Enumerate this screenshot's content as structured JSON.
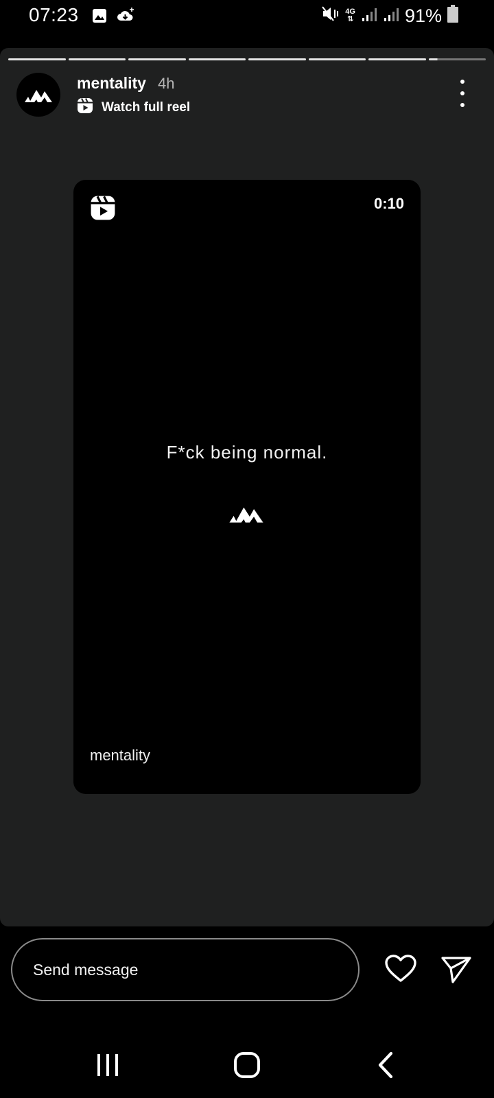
{
  "status_bar": {
    "time": "07:23",
    "network": "4G",
    "battery": "91%",
    "icons": [
      "gallery-icon",
      "cloud-download-icon",
      "mute-vibrate-icon",
      "signal-icon",
      "signal-icon",
      "battery-icon"
    ]
  },
  "story": {
    "progress_segments": 8,
    "active_segment_progress": 0.15,
    "username": "mentality",
    "time_ago": "4h",
    "reel_link_label": "Watch full reel",
    "reel": {
      "duration": "0:10",
      "caption": "F*ck being normal.",
      "author": "mentality"
    }
  },
  "message_bar": {
    "placeholder": "Send message"
  },
  "colors": {
    "story_background": "#1f2020",
    "reel_background": "#000000",
    "page_background": "#000000",
    "text": "#ffffff"
  }
}
